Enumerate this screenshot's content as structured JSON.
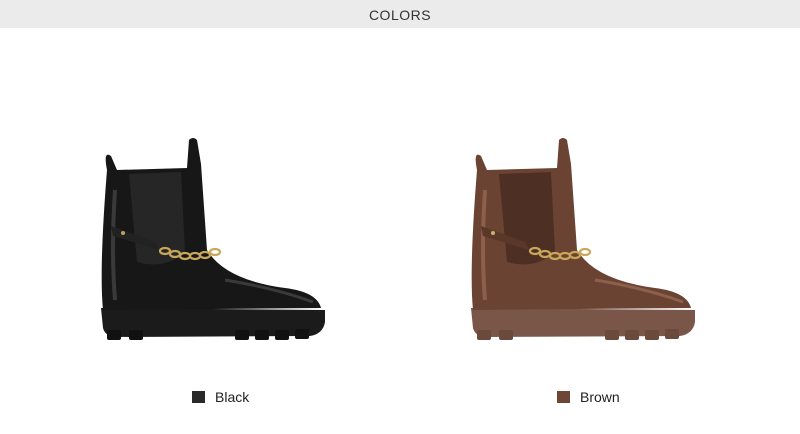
{
  "header": {
    "title": "COLORS"
  },
  "products": [
    {
      "label": "Black",
      "swatch_color": "#2a2a2a",
      "image_icon": "black-chelsea-boot-image"
    },
    {
      "label": "Brown",
      "swatch_color": "#6e4636",
      "image_icon": "brown-chelsea-boot-image"
    }
  ]
}
